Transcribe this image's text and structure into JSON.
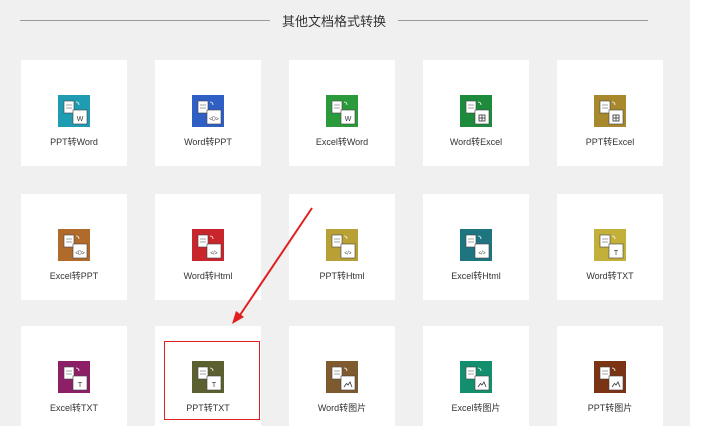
{
  "section": {
    "title": "其他文档格式转换"
  },
  "colors": {
    "highlight": "#e02020",
    "arrow": "#e02020"
  },
  "cards": [
    {
      "label": "PPT转Word",
      "color": "#1f9bb2",
      "glyph": "W"
    },
    {
      "label": "Word转PPT",
      "color": "#2f5fc4",
      "glyph": "ppt"
    },
    {
      "label": "Excel转Word",
      "color": "#2a9a3a",
      "glyph": "W"
    },
    {
      "label": "Word转Excel",
      "color": "#1d8a3c",
      "glyph": "xls"
    },
    {
      "label": "PPT转Excel",
      "color": "#a8882c",
      "glyph": "xls"
    },
    {
      "label": "Excel转PPT",
      "color": "#b06a2a",
      "glyph": "ppt"
    },
    {
      "label": "Word转Html",
      "color": "#c8262c",
      "glyph": "code"
    },
    {
      "label": "PPT转Html",
      "color": "#b8a035",
      "glyph": "code"
    },
    {
      "label": "Excel转Html",
      "color": "#1e7580",
      "glyph": "code"
    },
    {
      "label": "Word转TXT",
      "color": "#c3b03a",
      "glyph": "T"
    },
    {
      "label": "Excel转TXT",
      "color": "#8c1f66",
      "glyph": "T"
    },
    {
      "label": "PPT转TXT",
      "color": "#5c6030",
      "glyph": "T"
    },
    {
      "label": "Word转图片",
      "color": "#7e5a2e",
      "glyph": "img"
    },
    {
      "label": "Excel转图片",
      "color": "#138f6e",
      "glyph": "img"
    },
    {
      "label": "PPT转图片",
      "color": "#7a3414",
      "glyph": "img"
    }
  ]
}
